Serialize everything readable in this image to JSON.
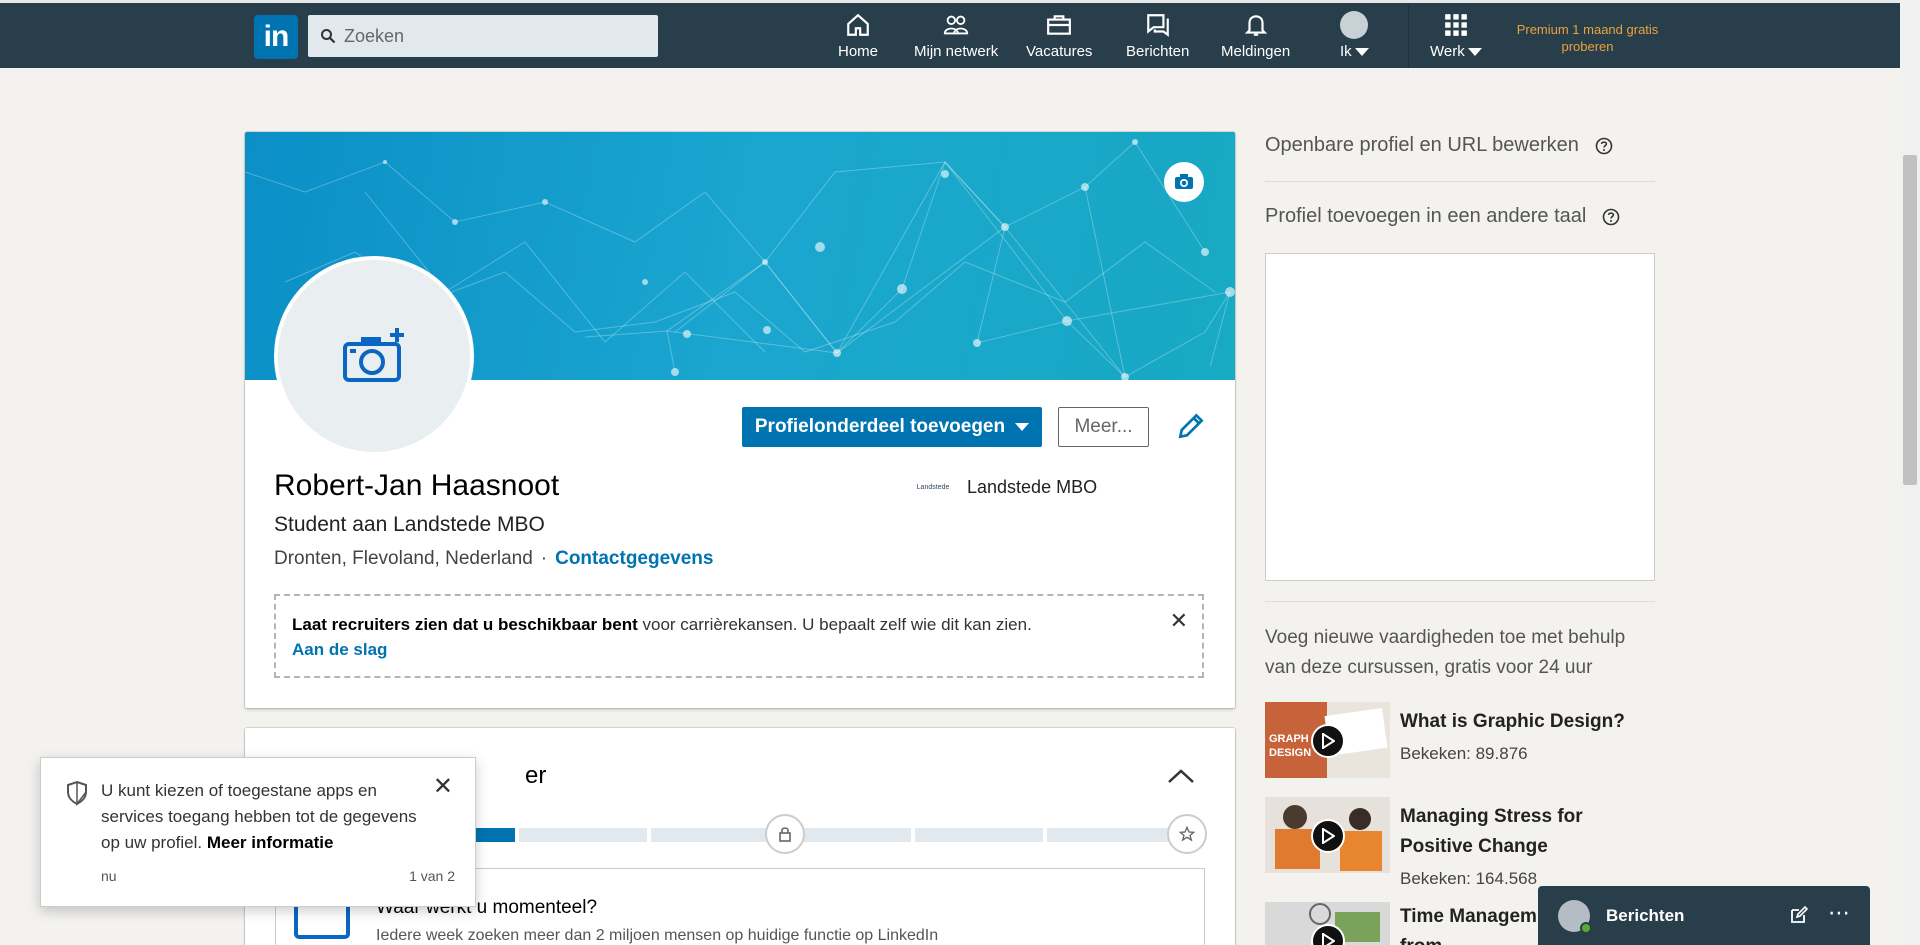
{
  "nav": {
    "logo": "in",
    "search_placeholder": "Zoeken",
    "items": [
      {
        "label": "Home"
      },
      {
        "label": "Mijn netwerk"
      },
      {
        "label": "Vacatures"
      },
      {
        "label": "Berichten"
      },
      {
        "label": "Meldingen"
      },
      {
        "label": "Ik"
      },
      {
        "label": "Werk"
      }
    ],
    "premium": "Premium 1 maand gratis proberen"
  },
  "profile": {
    "name": "Robert-Jan Haasnoot",
    "headline": "Student aan Landstede MBO",
    "location": "Dronten, Flevoland, Nederland",
    "separator": "·",
    "contact_link": "Contactgegevens",
    "school_logo_text": "Landstede",
    "school": "Landstede MBO",
    "add_section_button": "Profielonderdeel toevoegen",
    "more_button": "Meer...",
    "recruiter_bold": "Laat recruiters zien dat u beschikbaar bent",
    "recruiter_text": " voor carrièrekansen. U bepaalt zelf wie dit kan zien.",
    "recruiter_link": "Aan de slag",
    "close_glyph": "✕"
  },
  "strength": {
    "title_visible": "er",
    "progress_filled_segments": 1,
    "progress_total_segments": 7,
    "work_title": "Waar werkt u momenteel?",
    "work_sub": "Iedere week zoeken meer dan 2 miljoen mensen op huidige functie op LinkedIn"
  },
  "rail": {
    "public_profile": "Openbare profiel en URL bewerken",
    "other_language": "Profiel toevoegen in een andere taal",
    "help_glyph": "?",
    "courses_intro": "Voeg nieuwe vaardigheden toe met behulp van deze cursussen, gratis voor 24 uur",
    "courses": [
      {
        "title": "What is Graphic Design?",
        "views": "Bekeken: 89.876"
      },
      {
        "title": "Managing Stress for Positive Change",
        "views": "Bekeken: 164.568"
      },
      {
        "title": "Time Managem Working from"
      }
    ]
  },
  "toast": {
    "message": "U kunt kiezen of toegestane apps en services toegang hebben tot de gegevens op uw profiel. ",
    "link": "Meer informatie",
    "time": "nu",
    "count": "1 van 2",
    "close_glyph": "✕"
  },
  "messaging": {
    "title": "Berichten",
    "more": "⋯"
  },
  "colors": {
    "nav_bg": "#283e4a",
    "accent": "#0073b1",
    "premium": "#e7a33e",
    "online": "#5da82f"
  }
}
